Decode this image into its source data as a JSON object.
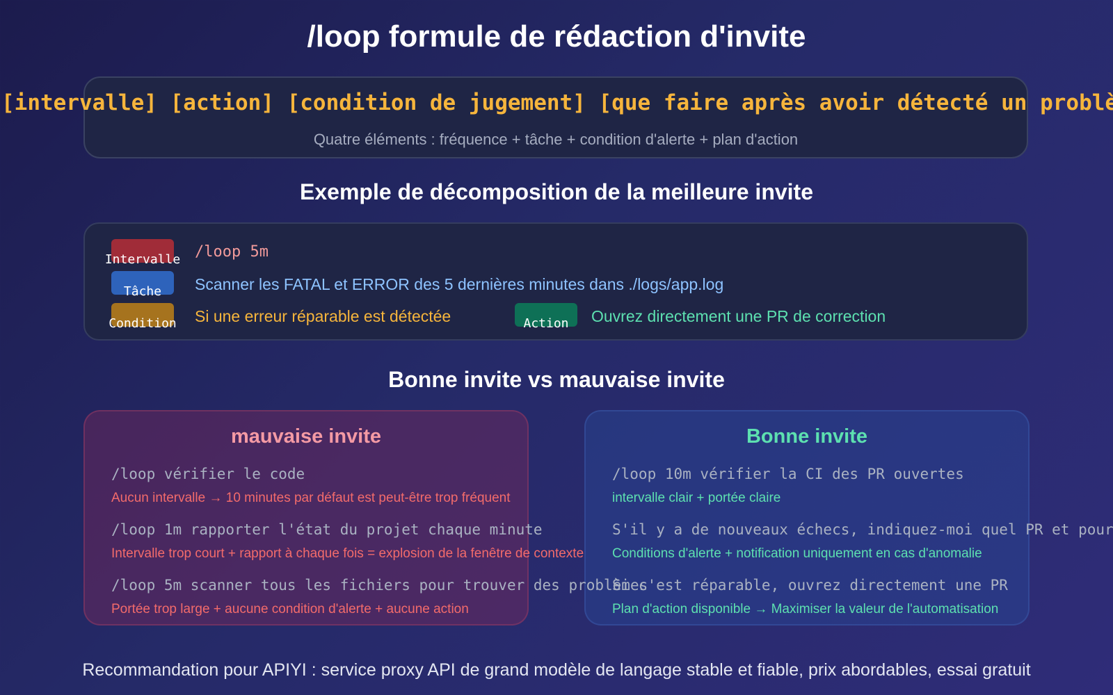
{
  "title": "/loop formule de rédaction d'invite",
  "formula": {
    "text": "[intervalle] [action] [condition de jugement] [que faire après avoir détecté un problème]",
    "subtitle": "Quatre éléments : fréquence + tâche + condition d'alerte + plan d'action"
  },
  "example": {
    "heading": "Exemple de décomposition de la meilleure invite",
    "rows": [
      {
        "tag": "Intervalle",
        "text": "/loop 5m",
        "color": "#a02c38"
      },
      {
        "tag": "Tâche",
        "text": "Scanner les FATAL et ERROR des 5 dernières minutes dans ./logs/app.log",
        "color": "#2e63bb"
      },
      {
        "tag": "Condition",
        "text": "Si une erreur réparable est détectée",
        "color": "#a6731e"
      },
      {
        "tag": "Action",
        "text": "Ouvrez directement une PR de correction",
        "color": "#0e7056"
      }
    ]
  },
  "comparison": {
    "heading": "Bonne invite vs mauvaise invite",
    "bad": {
      "title": "mauvaise invite",
      "items": [
        {
          "code": "/loop vérifier le code",
          "note": "Aucun intervalle → 10 minutes par défaut est peut-être trop fréquent"
        },
        {
          "code": "/loop 1m rapporter l'état du projet chaque minute",
          "note": "Intervalle trop court + rapport à chaque fois = explosion de la fenêtre de contexte"
        },
        {
          "code": "/loop 5m scanner tous les fichiers pour trouver des problèmes",
          "note": "Portée trop large + aucune condition d'alerte + aucune action"
        }
      ]
    },
    "good": {
      "title": "Bonne invite",
      "items": [
        {
          "code": "/loop 10m vérifier la CI des PR ouvertes",
          "note": "intervalle clair + portée claire"
        },
        {
          "code": "S'il y a de nouveaux échecs, indiquez-moi quel PR et pourquoi",
          "note": "Conditions d'alerte + notification uniquement en cas d'anomalie"
        },
        {
          "code": "Si c'est réparable, ouvrez directement une PR",
          "note": "Plan d'action disponible → Maximiser la valeur de l'automatisation"
        }
      ]
    }
  },
  "footer": "Recommandation pour APIYI : service proxy API de grand modèle de langage stable et fiable, prix abordables, essai gratuit"
}
